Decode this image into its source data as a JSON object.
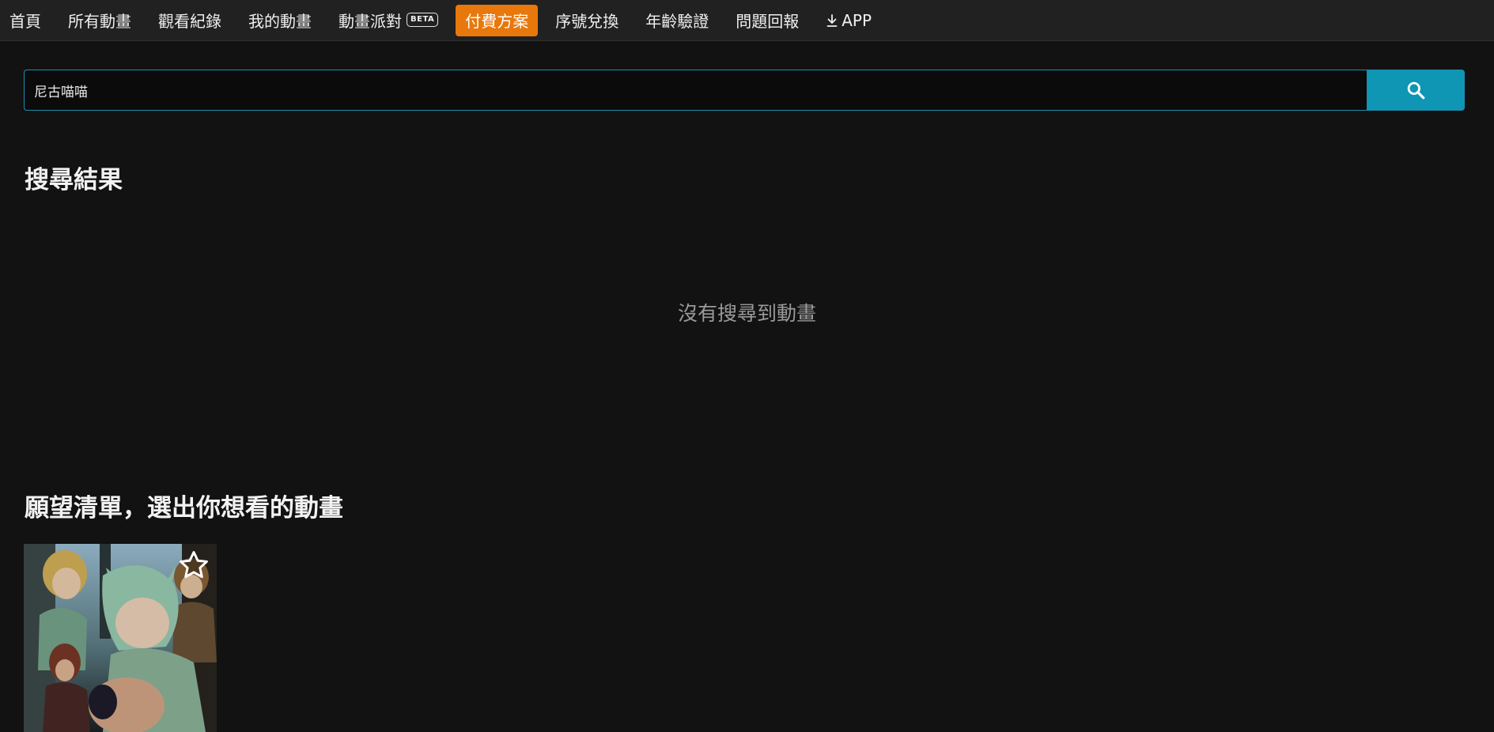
{
  "nav": {
    "items": [
      {
        "label": "首頁"
      },
      {
        "label": "所有動畫"
      },
      {
        "label": "觀看紀錄"
      },
      {
        "label": "我的動畫"
      },
      {
        "label": "動畫派對",
        "badge": "BETA"
      },
      {
        "label": "付費方案",
        "active": true
      },
      {
        "label": "序號兌換"
      },
      {
        "label": "年齡驗證"
      },
      {
        "label": "問題回報"
      },
      {
        "label": "APP",
        "icon": "download-icon"
      }
    ],
    "active_color": "#e8780c"
  },
  "search": {
    "value": "尼古喵喵",
    "button_icon": "search-icon",
    "button_color": "#0e96b4"
  },
  "results": {
    "title": "搜尋結果",
    "empty_message": "沒有搜尋到動畫"
  },
  "wishlist": {
    "title": "願望清單，選出你想看的動畫",
    "cards": [
      {
        "favorite_icon": "star-outline-icon"
      }
    ]
  }
}
